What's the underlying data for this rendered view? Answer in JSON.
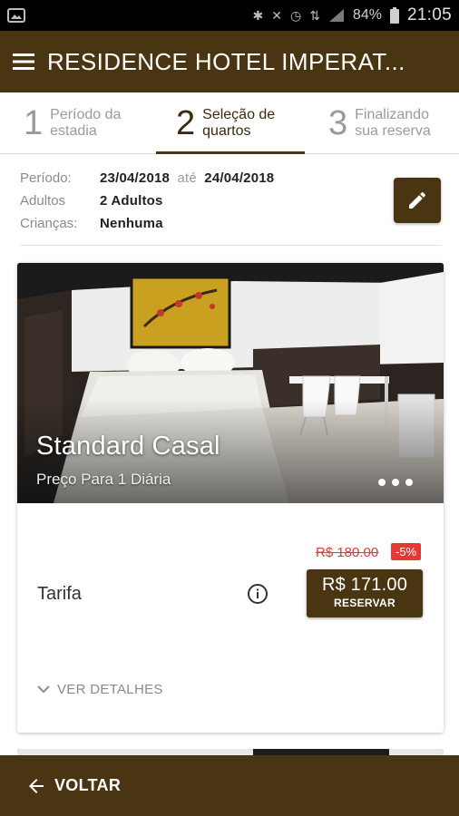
{
  "status_bar": {
    "battery": "84%",
    "time": "21:05"
  },
  "app_bar": {
    "title": "RESIDENCE HOTEL IMPERAT..."
  },
  "stepper": {
    "steps": [
      {
        "number": "1",
        "label_line1": "Período da",
        "label_line2": "estadia",
        "active": false
      },
      {
        "number": "2",
        "label_line1": "Seleção de",
        "label_line2": "quartos",
        "active": true
      },
      {
        "number": "3",
        "label_line1": "Finalizando",
        "label_line2": "sua reserva",
        "active": false
      }
    ]
  },
  "summary": {
    "period_label": "Período:",
    "period_start": "23/04/2018",
    "period_separator": "até",
    "period_end": "24/04/2018",
    "adults_label": "Adultos",
    "adults_value": "2 Adultos",
    "children_label": "Crianças:",
    "children_value": "Nenhuma"
  },
  "room": {
    "name": "Standard Casal",
    "subtitle": "Preço Para 1 Diária",
    "rate_label": "Tarifa",
    "old_price": "R$ 180.00",
    "discount": "-5%",
    "price": "R$ 171.00",
    "reserve_label": "RESERVAR",
    "details_label": "VER DETALHES"
  },
  "bottom_bar": {
    "back_label": "VOLTAR"
  },
  "colors": {
    "brand_brown": "#4a3512",
    "discount_red": "#e53935"
  }
}
